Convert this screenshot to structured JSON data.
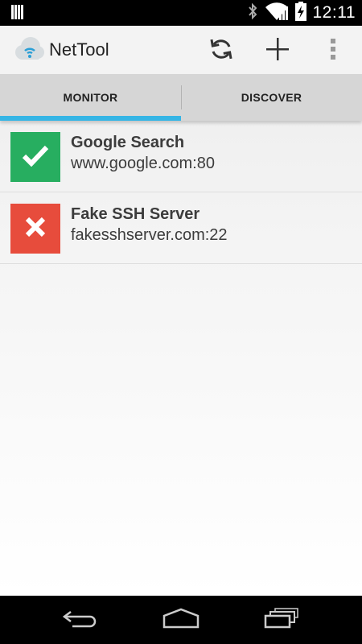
{
  "status_bar": {
    "time": "12:11",
    "icons": [
      "notification-icon",
      "bluetooth-icon",
      "wifi-icon",
      "battery-charging-icon"
    ]
  },
  "action_bar": {
    "title": "NetTool",
    "logo_icon": "cloud-wifi-icon",
    "actions": [
      {
        "name": "refresh",
        "icon": "refresh-icon"
      },
      {
        "name": "add",
        "icon": "plus-icon"
      },
      {
        "name": "overflow",
        "icon": "overflow-menu-icon"
      }
    ]
  },
  "tabs": [
    {
      "label": "MONITOR",
      "selected": true
    },
    {
      "label": "DISCOVER",
      "selected": false
    }
  ],
  "hosts": [
    {
      "name": "Google Search",
      "address": "www.google.com:80",
      "status": "up",
      "status_icon": "checkmark-icon",
      "color": "#27ae60"
    },
    {
      "name": "Fake SSH Server",
      "address": "fakesshserver.com:22",
      "status": "down",
      "status_icon": "cross-icon",
      "color": "#e74c3c"
    }
  ],
  "colors": {
    "accent": "#35b5e5",
    "up": "#27ae60",
    "down": "#e74c3c"
  },
  "nav_bar": {
    "buttons": [
      "back-icon",
      "home-icon",
      "recent-apps-icon"
    ]
  }
}
